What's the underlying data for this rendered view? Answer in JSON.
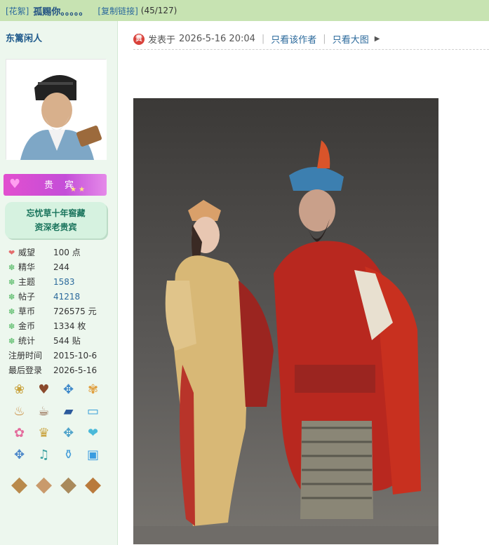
{
  "topbar": {
    "category": "[花絮]",
    "title": "孤赐你。。。。。",
    "copy_link": "[复制链接]",
    "count": "(45/127)"
  },
  "author": {
    "name": "东篱闲人",
    "vip_label": "贵宾",
    "honor_line1": "忘忧草十年窖藏",
    "honor_line2": "资深老贵宾",
    "stats": [
      {
        "label": "威望",
        "value": "100 点",
        "icon": "heart-icon"
      },
      {
        "label": "精华",
        "value": "244",
        "icon": "clover-icon"
      },
      {
        "label": "主题",
        "value": "1583",
        "icon": "clover-icon"
      },
      {
        "label": "帖子",
        "value": "41218",
        "icon": "clover-icon"
      },
      {
        "label": "草币",
        "value": "726575 元",
        "icon": "clover-icon"
      },
      {
        "label": "金币",
        "value": "1334 枚",
        "icon": "clover-icon"
      },
      {
        "label": "统计",
        "value": "544 贴",
        "icon": "clover-icon"
      }
    ],
    "register_label": "注册时间",
    "register_date": "2015-10-6",
    "last_login_label": "最后登录",
    "last_login_date": "2026-5-16"
  },
  "post": {
    "posted_prefix": "发表于",
    "posted_time": "2026-5-16 20:04",
    "only_author": "只看该作者",
    "view_large": "只看大图"
  },
  "colors": {
    "topbar_bg": "#c7e3b2",
    "sidebar_bg": "#edf7ee",
    "link": "#2c6a9c",
    "vip_magenta": "#d44fd4",
    "honor_green": "#18735b"
  }
}
